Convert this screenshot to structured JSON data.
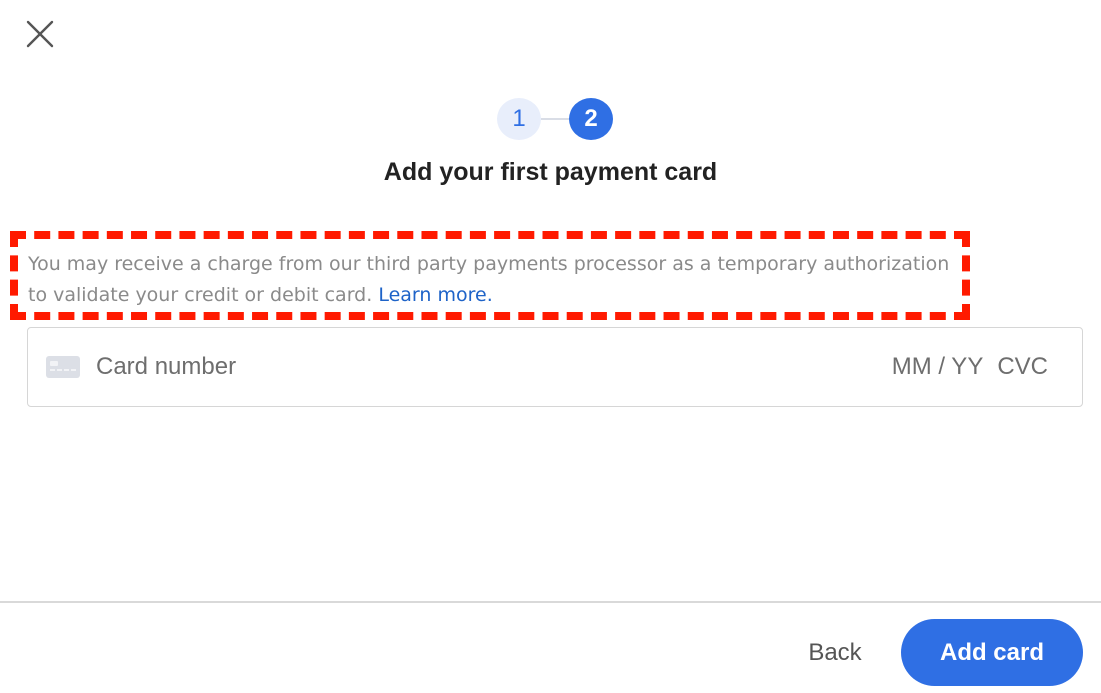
{
  "dialog": {
    "title": "Add your first payment card"
  },
  "stepper": {
    "steps": [
      "1",
      "2"
    ],
    "current_step": 2
  },
  "notice": {
    "text": "You may receive a charge from our third party payments processor as a temporary authorization to validate your credit or debit card.",
    "link_label": "Learn more."
  },
  "card_form": {
    "card_number_placeholder": "Card number",
    "expiry_placeholder": "MM / YY",
    "cvc_placeholder": "CVC"
  },
  "footer": {
    "back_label": "Back",
    "add_label": "Add card"
  },
  "colors": {
    "accent": "#2f6fe4",
    "highlight_border": "#ff1a00",
    "link": "#1e63c8"
  }
}
